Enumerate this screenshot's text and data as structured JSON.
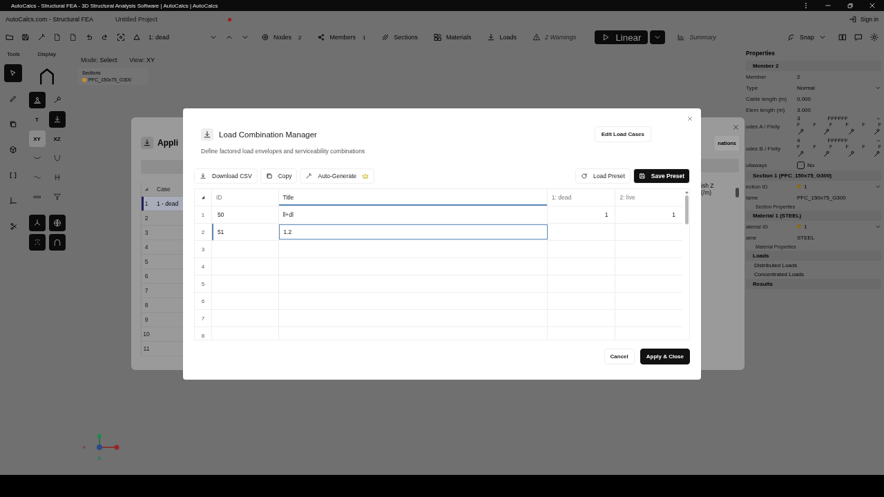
{
  "window": {
    "title": "AutoCalcs - Structural FEA - 3D Structural Analysis Software | AutoCalcs | AutoCalcs"
  },
  "app_header": {
    "title": "AutoCalcs.com - Structural FEA",
    "project": "Untitled Project",
    "unsaved": true,
    "sign_in": "Sign in"
  },
  "toolbar": {
    "load_case": "1: dead",
    "items": [
      {
        "label": "Nodes",
        "count": "2",
        "disabled": false
      },
      {
        "label": "Members",
        "count": "1",
        "disabled": false
      },
      {
        "label": "Sections",
        "disabled": false
      },
      {
        "label": "Materials",
        "disabled": false
      },
      {
        "label": "Loads",
        "disabled": false
      },
      {
        "label": "2 Warnings",
        "disabled": true
      }
    ],
    "run": "Linear",
    "summary": "Summary",
    "snap": "Snap"
  },
  "left_panel": {
    "tabs": [
      "Tools",
      "Display"
    ],
    "tools": [
      {
        "selected": true
      },
      {
        "selected": false
      },
      {
        "selected": false
      },
      {
        "selected": false
      },
      {
        "selected": false
      },
      {
        "selected": false
      },
      {
        "selected": false
      }
    ],
    "display": [
      {
        "on": true
      },
      {
        "on": false
      },
      {
        "label": "T",
        "on": false
      },
      {
        "on": true
      },
      {
        "label": "XY",
        "on": true
      },
      {
        "label": "XZ",
        "on": false
      },
      {
        "on": false
      },
      {
        "on": false
      },
      {
        "on": false
      },
      {
        "on": false
      },
      {
        "on": false
      },
      {
        "on": false
      },
      {
        "on": true
      },
      {
        "on": true
      },
      {
        "on": true
      },
      {
        "on": true
      }
    ]
  },
  "canvas": {
    "mode_label": "Mode:",
    "mode": "Select",
    "view_label": "View:",
    "view": "XY",
    "legend_title": "Sections",
    "legend": [
      {
        "label": "PFC_150x75_G300",
        "color": "#c8902a"
      }
    ]
  },
  "background_dialog": {
    "title": "Appli",
    "side_button": "nations",
    "column": "Case",
    "column_right": [
      "ish Z",
      "(/m)"
    ],
    "rows": [
      {
        "num": "1",
        "value": "1 - dead",
        "selected": true
      },
      {
        "num": "2",
        "selected": false
      },
      {
        "num": "3",
        "selected": false
      },
      {
        "num": "4",
        "selected": false
      },
      {
        "num": "5",
        "selected": false
      },
      {
        "num": "6",
        "selected": false
      },
      {
        "num": "7",
        "selected": false
      },
      {
        "num": "8",
        "selected": false
      },
      {
        "num": "9",
        "selected": false
      },
      {
        "num": "10",
        "selected": false
      },
      {
        "num": "11",
        "selected": false
      }
    ]
  },
  "properties": {
    "title": "Properties",
    "sections": [
      {
        "title": "Member 2",
        "fields": [
          {
            "label": "Member",
            "value": "2"
          },
          {
            "label": "Type",
            "value": "Normal",
            "kind": "select"
          },
          {
            "label": "Cable length (m)",
            "value": "0.000"
          },
          {
            "label": "Elem length (m)",
            "value": "3.000"
          }
        ],
        "ends": [
          {
            "node": "3",
            "code": "FFFFFF",
            "label": "odes A / Fixity",
            "flags": [
              "F",
              "F",
              "F",
              "F",
              "F",
              "F"
            ]
          },
          {
            "node": "4",
            "code": "FFFFFF",
            "label": "odes B / Fixity",
            "flags": [
              "F",
              "F",
              "F",
              "F",
              "F",
              "F"
            ]
          }
        ],
        "checkbox": {
          "label": "ullaways",
          "text": "No",
          "checked": false
        }
      },
      {
        "title": "Section 1 (PFC_150x75_G300)",
        "fields": [
          {
            "label": "ection ID",
            "value": "1",
            "kind": "id"
          },
          {
            "label": "lame",
            "value": "PFC_150x75_G300"
          }
        ],
        "sub": "Section Properties"
      },
      {
        "title": "Material 1 (STEEL)",
        "fields": [
          {
            "label": "aterial ID",
            "value": "1",
            "kind": "id"
          },
          {
            "label": "ame",
            "value": "STEEL"
          }
        ],
        "sub": "Material Properties"
      }
    ],
    "loads": {
      "title": "Loads",
      "items": [
        "Distributed Loads",
        "Concentrated Loads"
      ]
    },
    "results": "Results"
  },
  "modal": {
    "title": "Load Combination Manager",
    "subtitle": "Define factored load envelopes and serviceability combinations",
    "edit_button": "Edit Load Cases",
    "actions_left": [
      "Download CSV",
      "Copy",
      "Auto-Generate"
    ],
    "actions_right": [
      "Load Preset",
      "Save Preset"
    ],
    "columns": [
      "ID",
      "Title",
      "1: dead",
      "2: live"
    ],
    "rows": [
      {
        "num": "1",
        "id": "50",
        "title": "ll+dl",
        "dead": "1",
        "live": "1",
        "selected": false,
        "editing": false
      },
      {
        "num": "2",
        "id": "51",
        "title": "1.2",
        "selected": true,
        "editing": true
      },
      {
        "num": "3",
        "selected": false,
        "editing": false
      },
      {
        "num": "4",
        "selected": false,
        "editing": false
      },
      {
        "num": "5",
        "selected": false,
        "editing": false
      },
      {
        "num": "6",
        "selected": false,
        "editing": false
      },
      {
        "num": "7",
        "selected": false,
        "editing": false
      },
      {
        "num": "8",
        "selected": false,
        "editing": false
      }
    ],
    "cancel": "Cancel",
    "apply": "Apply & Close"
  }
}
